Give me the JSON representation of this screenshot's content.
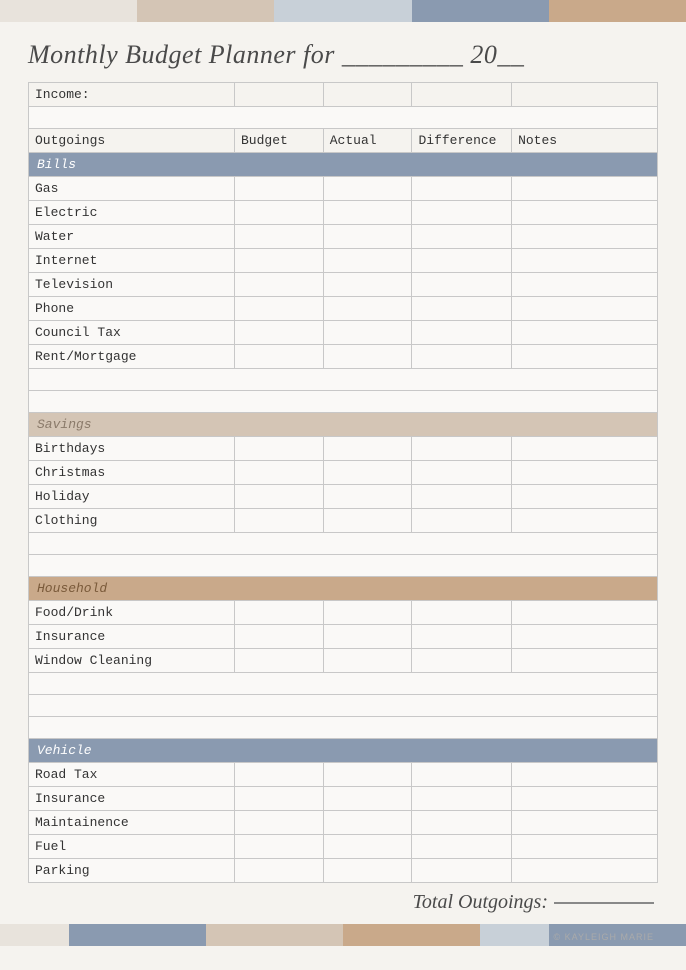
{
  "topBar": {
    "segments": [
      {
        "color": "#e8e3dc"
      },
      {
        "color": "#e8e3dc"
      },
      {
        "color": "#d4c5b5"
      },
      {
        "color": "#d4c5b5"
      },
      {
        "color": "#c8d0d8"
      },
      {
        "color": "#c8d0d8"
      },
      {
        "color": "#8a9ab0"
      },
      {
        "color": "#8a9ab0"
      },
      {
        "color": "#c9a98a"
      },
      {
        "color": "#c9a98a"
      }
    ]
  },
  "bottomBar": {
    "segments": [
      {
        "color": "#e8e3dc"
      },
      {
        "color": "#8a9ab0"
      },
      {
        "color": "#8a9ab0"
      },
      {
        "color": "#d4c5b5"
      },
      {
        "color": "#d4c5b5"
      },
      {
        "color": "#c9a98a"
      },
      {
        "color": "#c9a98a"
      },
      {
        "color": "#c8d0d8"
      },
      {
        "color": "#8a9ab0"
      },
      {
        "color": "#8a9ab0"
      }
    ]
  },
  "title": "Monthly Budget Planner for _________ 20__",
  "table": {
    "incomeLabel": "Income:",
    "headers": {
      "outgoings": "Outgoings",
      "budget": "Budget",
      "actual": "Actual",
      "difference": "Difference",
      "notes": "Notes"
    },
    "sections": [
      {
        "name": "Bills",
        "type": "bills",
        "items": [
          "Gas",
          "Electric",
          "Water",
          "Internet",
          "Television",
          "Phone",
          "Council Tax",
          "Rent/Mortgage"
        ]
      },
      {
        "name": "Savings",
        "type": "savings",
        "items": [
          "Birthdays",
          "Christmas",
          "Holiday",
          "Clothing"
        ]
      },
      {
        "name": "Household",
        "type": "household",
        "items": [
          "Food/Drink",
          "Insurance",
          "Window Cleaning"
        ]
      },
      {
        "name": "Vehicle",
        "type": "vehicle",
        "items": [
          "Road Tax",
          "Insurance",
          "Maintainence",
          "Fuel",
          "Parking"
        ]
      }
    ]
  },
  "totalLabel": "Total Outgoings:",
  "copyright": "© Kayleigh Marie"
}
